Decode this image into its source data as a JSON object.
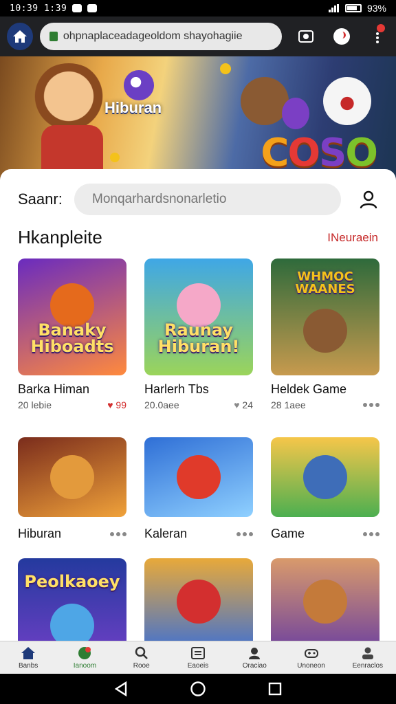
{
  "status_bar": {
    "time": "10:39 1:39",
    "battery": "93%"
  },
  "browser": {
    "url": "ohpnaplaceadageoldom shayohagiie"
  },
  "banner": {
    "title": "Hiburan",
    "logo_text": [
      "C",
      "O",
      "S",
      "O"
    ]
  },
  "search": {
    "label": "Saanr:",
    "placeholder": "Monqarhardsnonarletio"
  },
  "section": {
    "title": "Hkanpleite",
    "link": "INeuraein"
  },
  "cards_row1": [
    {
      "name": "Barka Himan",
      "meta": "20 lebie",
      "likes": "99",
      "thumb_text": "Banaky Hiboadts",
      "c1": "#6a2bbf",
      "c2": "#ff8a3d",
      "glyph": "#e56a1c"
    },
    {
      "name": "Harlerh Tbs",
      "meta": "20.0aee",
      "likes": "24",
      "thumb_text": "Raunay Hiburan!",
      "c1": "#3fa7e6",
      "c2": "#9bd45a",
      "glyph": "#f5a8c8"
    },
    {
      "name": "Heldek Game",
      "meta": "28 1aee",
      "likes": "",
      "thumb_text": "WHMOC WAANES",
      "c1": "#2e6a3b",
      "c2": "#c79a4e",
      "glyph": "#8a5a33"
    }
  ],
  "cards_row2": [
    {
      "name": "Hiburan",
      "c1": "#7a2c1c",
      "c2": "#f0a23a",
      "glyph": "#e39a3c"
    },
    {
      "name": "Kaleran",
      "c1": "#2f6fd6",
      "c2": "#8fd0ff",
      "glyph": "#e03a2a"
    },
    {
      "name": "Game",
      "c1": "#f6c64a",
      "c2": "#4caf50",
      "glyph": "#3e6db8"
    }
  ],
  "cards_row3": [
    {
      "thumb_text": "Peolkaoey",
      "c1": "#243a9e",
      "c2": "#6b3fc4",
      "glyph": "#4ea6e6"
    },
    {
      "thumb_text": "",
      "c1": "#e8a93a",
      "c2": "#3b6fd6",
      "glyph": "#d32f2f"
    },
    {
      "thumb_text": "",
      "c1": "#d99a6b",
      "c2": "#6b3fa0",
      "glyph": "#c47a3a"
    }
  ],
  "bottom_nav": [
    {
      "label": "Banbs",
      "icon": "home-icon",
      "active": false
    },
    {
      "label": "Ianoom",
      "icon": "shopping-icon",
      "active": true
    },
    {
      "label": "Rooe",
      "icon": "search-icon",
      "active": false
    },
    {
      "label": "Eaoeis",
      "icon": "calendar-icon",
      "active": false
    },
    {
      "label": "Oraciao",
      "icon": "user-icon",
      "active": false
    },
    {
      "label": "Unoneon",
      "icon": "gamepad-icon",
      "active": false
    },
    {
      "label": "Eenraclos",
      "icon": "account-icon",
      "active": false
    }
  ]
}
